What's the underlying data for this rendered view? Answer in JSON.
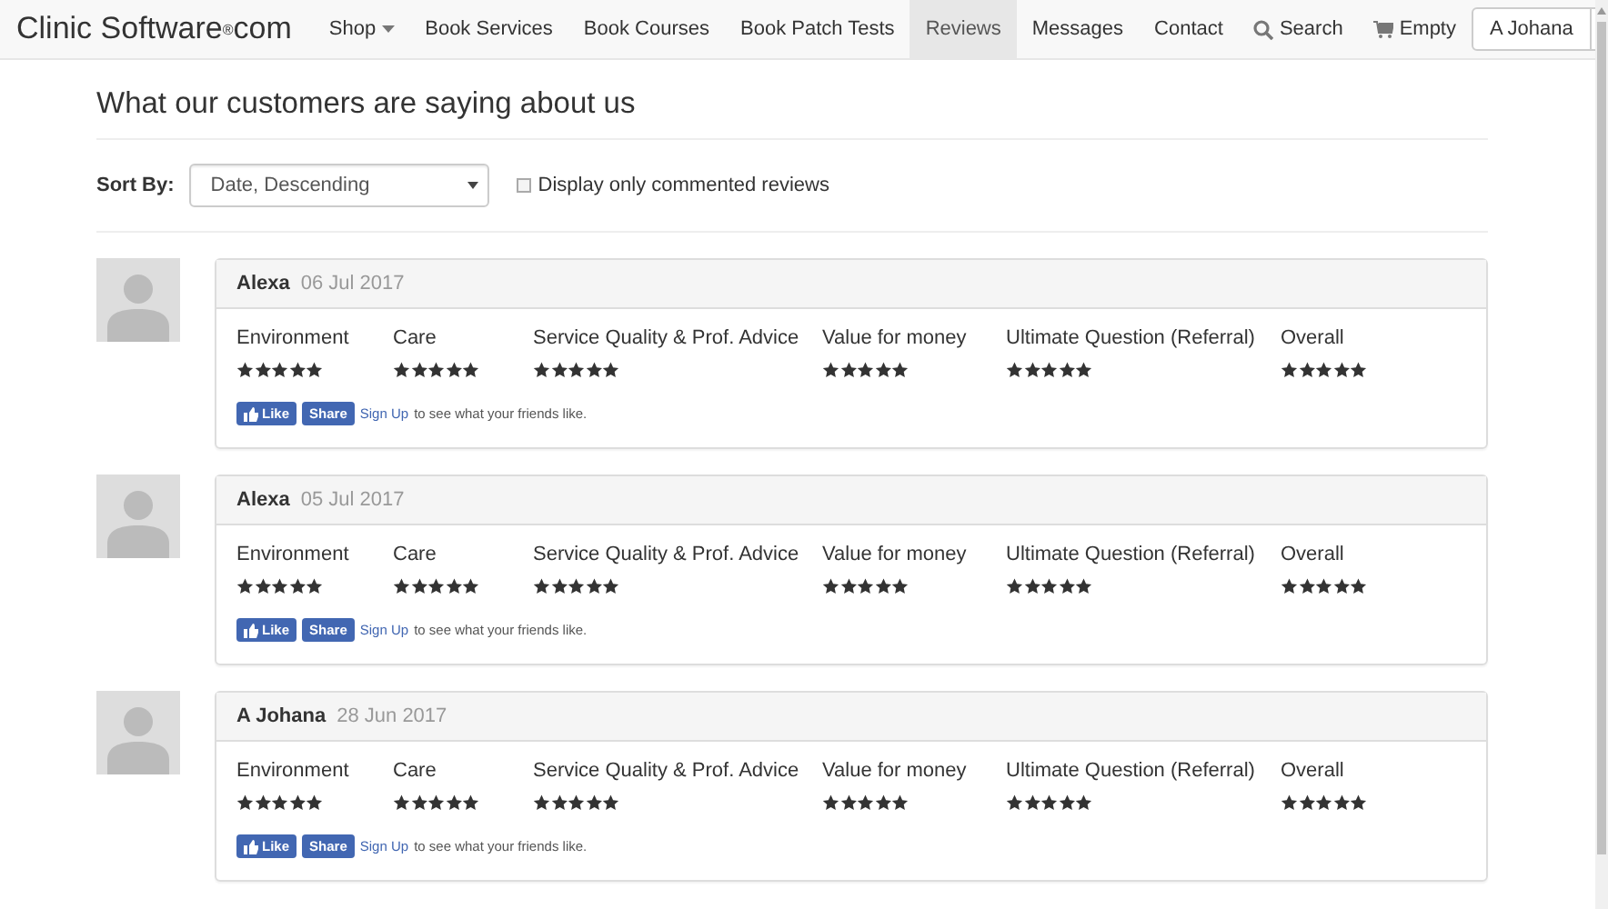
{
  "navbar": {
    "brand": "Clinic Software",
    "brand_mark": "®",
    "brand_suffix": "com",
    "items": [
      {
        "label": "Shop",
        "kind": "dropdown",
        "selected": false
      },
      {
        "label": "Book Services",
        "kind": "link",
        "selected": false
      },
      {
        "label": "Book Courses",
        "kind": "link",
        "selected": false
      },
      {
        "label": "Book Patch Tests",
        "kind": "link",
        "selected": false
      },
      {
        "label": "Reviews",
        "kind": "link",
        "selected": true
      },
      {
        "label": "Messages",
        "kind": "link",
        "selected": false
      },
      {
        "label": "Contact",
        "kind": "link",
        "selected": false
      },
      {
        "label": "Search",
        "kind": "search",
        "selected": false
      },
      {
        "label": "Empty",
        "kind": "cart",
        "selected": false
      }
    ],
    "user_button": "A Johana"
  },
  "heading": "What our customers are saying about us",
  "sort": {
    "label": "Sort By:",
    "value": "Date, Descending",
    "filter_label": "Display only commented reviews",
    "filter_checked": false
  },
  "reviews": [
    {
      "name": "Alexa",
      "date": "06 Jul 2017",
      "ratings": [
        {
          "label": "Environment",
          "stars": 5
        },
        {
          "label": "Care",
          "stars": 5
        },
        {
          "label": "Service Quality & Prof. Advice",
          "stars": 5
        },
        {
          "label": "Value for money",
          "stars": 5
        },
        {
          "label": "Ultimate Question (Referral)",
          "stars": 5
        },
        {
          "label": "Overall",
          "stars": 5
        }
      ],
      "like": "Like",
      "share": "Share",
      "signup": "Sign Up",
      "signup_text": "to see what your friends like."
    },
    {
      "name": "Alexa",
      "date": "05 Jul 2017",
      "ratings": [
        {
          "label": "Environment",
          "stars": 5
        },
        {
          "label": "Care",
          "stars": 5
        },
        {
          "label": "Service Quality & Prof. Advice",
          "stars": 5
        },
        {
          "label": "Value for money",
          "stars": 5
        },
        {
          "label": "Ultimate Question (Referral)",
          "stars": 5
        },
        {
          "label": "Overall",
          "stars": 5
        }
      ],
      "like": "Like",
      "share": "Share",
      "signup": "Sign Up",
      "signup_text": "to see what your friends like."
    },
    {
      "name": "A Johana",
      "date": "28 Jun 2017",
      "ratings": [
        {
          "label": "Environment",
          "stars": 5
        },
        {
          "label": "Care",
          "stars": 5
        },
        {
          "label": "Service Quality & Prof. Advice",
          "stars": 5
        },
        {
          "label": "Value for money",
          "stars": 5
        },
        {
          "label": "Ultimate Question (Referral)",
          "stars": 5
        },
        {
          "label": "Overall",
          "stars": 5
        }
      ],
      "like": "Like",
      "share": "Share",
      "signup": "Sign Up",
      "signup_text": "to see what your friends like."
    }
  ]
}
